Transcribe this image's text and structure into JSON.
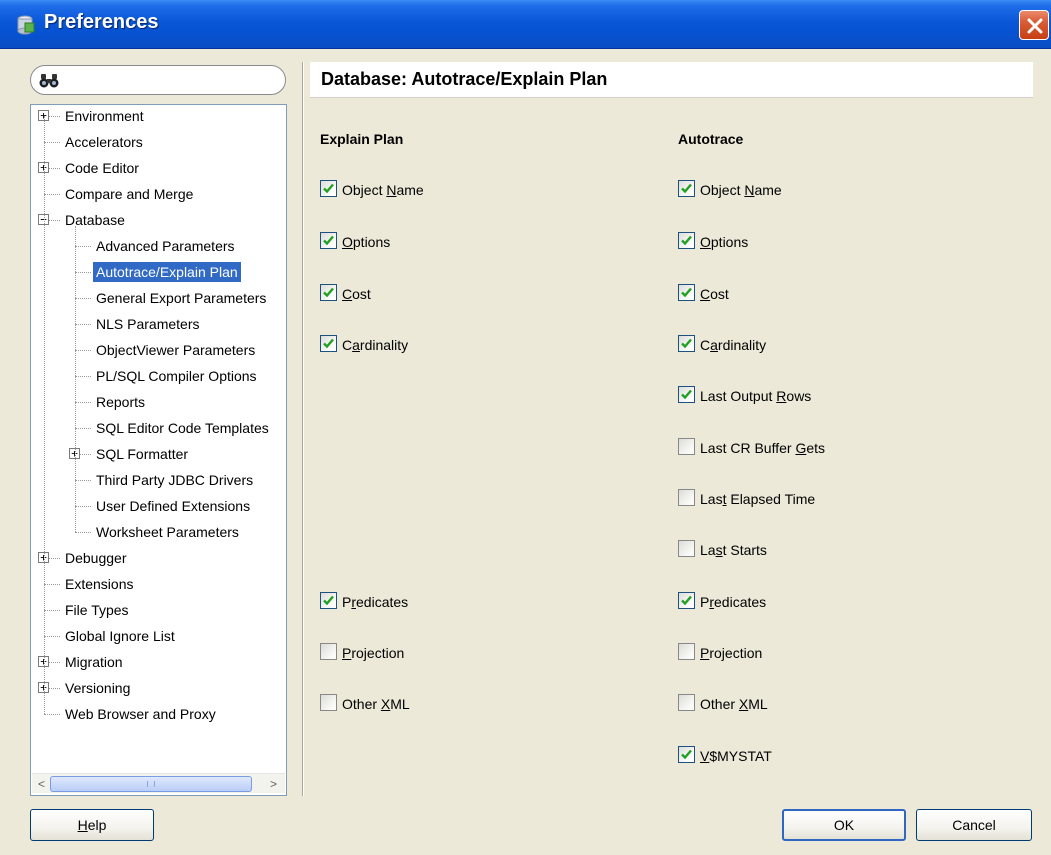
{
  "window": {
    "title": "Preferences"
  },
  "tree": {
    "items": [
      {
        "label": "Environment",
        "expander": "+"
      },
      {
        "label": "Accelerators"
      },
      {
        "label": "Code Editor",
        "expander": "+"
      },
      {
        "label": "Compare and Merge"
      },
      {
        "label": "Database",
        "expander": "−"
      },
      {
        "label": "Advanced Parameters"
      },
      {
        "label": "Autotrace/Explain Plan",
        "selected": true
      },
      {
        "label": "General Export Parameters"
      },
      {
        "label": "NLS Parameters"
      },
      {
        "label": "ObjectViewer Parameters"
      },
      {
        "label": "PL/SQL Compiler Options"
      },
      {
        "label": "Reports"
      },
      {
        "label": "SQL Editor Code Templates"
      },
      {
        "label": "SQL Formatter",
        "expander": "+"
      },
      {
        "label": "Third Party JDBC Drivers"
      },
      {
        "label": "User Defined Extensions"
      },
      {
        "label": "Worksheet Parameters"
      },
      {
        "label": "Debugger",
        "expander": "+"
      },
      {
        "label": "Extensions"
      },
      {
        "label": "File Types"
      },
      {
        "label": "Global Ignore List"
      },
      {
        "label": "Migration",
        "expander": "+"
      },
      {
        "label": "Versioning",
        "expander": "+"
      },
      {
        "label": "Web Browser and Proxy"
      }
    ],
    "scroll_left_arrow": "<",
    "scroll_right_arrow": ">"
  },
  "panel": {
    "title": "Database: Autotrace/Explain Plan",
    "explain_plan": {
      "heading": "Explain Plan",
      "options": [
        {
          "pre": "Object ",
          "key": "N",
          "post": "ame",
          "checked": true
        },
        {
          "pre": "",
          "key": "O",
          "post": "ptions",
          "checked": true
        },
        {
          "pre": "",
          "key": "C",
          "post": "ost",
          "checked": true
        },
        {
          "pre": "C",
          "key": "a",
          "post": "rdinality",
          "checked": true
        },
        {
          "pre": "P",
          "key": "r",
          "post": "edicates",
          "checked": true
        },
        {
          "pre": "",
          "key": "P",
          "post": "rojection",
          "checked": false
        },
        {
          "pre": "Other ",
          "key": "X",
          "post": "ML",
          "checked": false
        }
      ]
    },
    "autotrace": {
      "heading": "Autotrace",
      "options": [
        {
          "pre": "Object ",
          "key": "N",
          "post": "ame",
          "checked": true
        },
        {
          "pre": "",
          "key": "O",
          "post": "ptions",
          "checked": true
        },
        {
          "pre": "",
          "key": "C",
          "post": "ost",
          "checked": true
        },
        {
          "pre": "C",
          "key": "a",
          "post": "rdinality",
          "checked": true
        },
        {
          "pre": "Last Output ",
          "key": "R",
          "post": "ows",
          "checked": true
        },
        {
          "pre": "Last CR Buffer ",
          "key": "G",
          "post": "ets",
          "checked": false
        },
        {
          "pre": "Las",
          "key": "t",
          "post": " Elapsed Time",
          "checked": false
        },
        {
          "pre": "La",
          "key": "s",
          "post": "t Starts",
          "checked": false
        },
        {
          "pre": "P",
          "key": "r",
          "post": "edicates",
          "checked": true
        },
        {
          "pre": "",
          "key": "P",
          "post": "rojection",
          "checked": false
        },
        {
          "pre": "Other ",
          "key": "X",
          "post": "ML",
          "checked": false
        },
        {
          "pre": "",
          "key": "V",
          "post": "$MYSTAT",
          "checked": true
        }
      ]
    }
  },
  "buttons": {
    "help": {
      "pre": "",
      "key": "H",
      "post": "elp"
    },
    "ok": "OK",
    "cancel": "Cancel"
  },
  "colors": {
    "title_bar": "#0a57d8",
    "selection": "#316ac5",
    "dialog_bg": "#ece9d8"
  }
}
